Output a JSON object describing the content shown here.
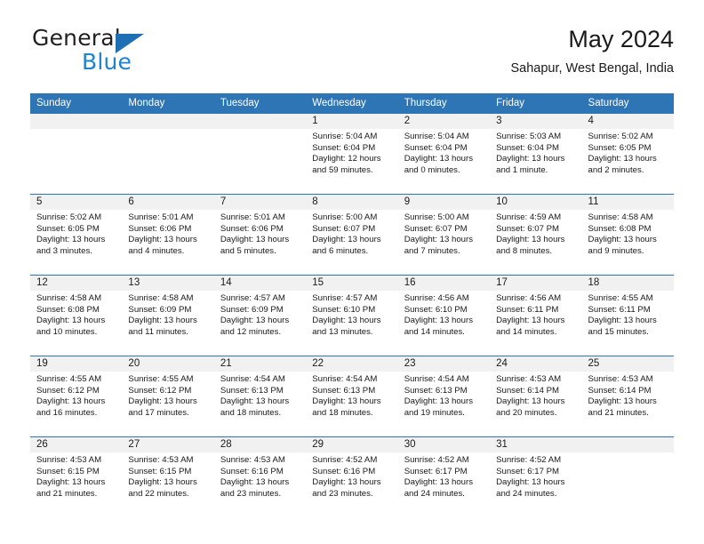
{
  "brand": {
    "name_part1": "General",
    "name_part2": "Blue",
    "triangle_color": "#1f6fb4",
    "blue_color": "#1f83d0"
  },
  "header": {
    "title": "May 2024",
    "subtitle": "Sahapur, West Bengal, India",
    "header_bg": "#2e75b6",
    "header_text_color": "#ffffff"
  },
  "calendar": {
    "weekday_headers": [
      "Sunday",
      "Monday",
      "Tuesday",
      "Wednesday",
      "Thursday",
      "Friday",
      "Saturday"
    ],
    "weeks": [
      [
        {
          "day": "",
          "lines": [
            "",
            "",
            "",
            ""
          ],
          "empty": true
        },
        {
          "day": "",
          "lines": [
            "",
            "",
            "",
            ""
          ],
          "empty": true
        },
        {
          "day": "",
          "lines": [
            "",
            "",
            "",
            ""
          ],
          "empty": true
        },
        {
          "day": "1",
          "lines": [
            "Sunrise: 5:04 AM",
            "Sunset: 6:04 PM",
            "Daylight: 12 hours",
            "and 59 minutes."
          ]
        },
        {
          "day": "2",
          "lines": [
            "Sunrise: 5:04 AM",
            "Sunset: 6:04 PM",
            "Daylight: 13 hours",
            "and 0 minutes."
          ]
        },
        {
          "day": "3",
          "lines": [
            "Sunrise: 5:03 AM",
            "Sunset: 6:04 PM",
            "Daylight: 13 hours",
            "and 1 minute."
          ]
        },
        {
          "day": "4",
          "lines": [
            "Sunrise: 5:02 AM",
            "Sunset: 6:05 PM",
            "Daylight: 13 hours",
            "and 2 minutes."
          ]
        }
      ],
      [
        {
          "day": "5",
          "lines": [
            "Sunrise: 5:02 AM",
            "Sunset: 6:05 PM",
            "Daylight: 13 hours",
            "and 3 minutes."
          ]
        },
        {
          "day": "6",
          "lines": [
            "Sunrise: 5:01 AM",
            "Sunset: 6:06 PM",
            "Daylight: 13 hours",
            "and 4 minutes."
          ]
        },
        {
          "day": "7",
          "lines": [
            "Sunrise: 5:01 AM",
            "Sunset: 6:06 PM",
            "Daylight: 13 hours",
            "and 5 minutes."
          ]
        },
        {
          "day": "8",
          "lines": [
            "Sunrise: 5:00 AM",
            "Sunset: 6:07 PM",
            "Daylight: 13 hours",
            "and 6 minutes."
          ]
        },
        {
          "day": "9",
          "lines": [
            "Sunrise: 5:00 AM",
            "Sunset: 6:07 PM",
            "Daylight: 13 hours",
            "and 7 minutes."
          ]
        },
        {
          "day": "10",
          "lines": [
            "Sunrise: 4:59 AM",
            "Sunset: 6:07 PM",
            "Daylight: 13 hours",
            "and 8 minutes."
          ]
        },
        {
          "day": "11",
          "lines": [
            "Sunrise: 4:58 AM",
            "Sunset: 6:08 PM",
            "Daylight: 13 hours",
            "and 9 minutes."
          ]
        }
      ],
      [
        {
          "day": "12",
          "lines": [
            "Sunrise: 4:58 AM",
            "Sunset: 6:08 PM",
            "Daylight: 13 hours",
            "and 10 minutes."
          ]
        },
        {
          "day": "13",
          "lines": [
            "Sunrise: 4:58 AM",
            "Sunset: 6:09 PM",
            "Daylight: 13 hours",
            "and 11 minutes."
          ]
        },
        {
          "day": "14",
          "lines": [
            "Sunrise: 4:57 AM",
            "Sunset: 6:09 PM",
            "Daylight: 13 hours",
            "and 12 minutes."
          ]
        },
        {
          "day": "15",
          "lines": [
            "Sunrise: 4:57 AM",
            "Sunset: 6:10 PM",
            "Daylight: 13 hours",
            "and 13 minutes."
          ]
        },
        {
          "day": "16",
          "lines": [
            "Sunrise: 4:56 AM",
            "Sunset: 6:10 PM",
            "Daylight: 13 hours",
            "and 14 minutes."
          ]
        },
        {
          "day": "17",
          "lines": [
            "Sunrise: 4:56 AM",
            "Sunset: 6:11 PM",
            "Daylight: 13 hours",
            "and 14 minutes."
          ]
        },
        {
          "day": "18",
          "lines": [
            "Sunrise: 4:55 AM",
            "Sunset: 6:11 PM",
            "Daylight: 13 hours",
            "and 15 minutes."
          ]
        }
      ],
      [
        {
          "day": "19",
          "lines": [
            "Sunrise: 4:55 AM",
            "Sunset: 6:12 PM",
            "Daylight: 13 hours",
            "and 16 minutes."
          ]
        },
        {
          "day": "20",
          "lines": [
            "Sunrise: 4:55 AM",
            "Sunset: 6:12 PM",
            "Daylight: 13 hours",
            "and 17 minutes."
          ]
        },
        {
          "day": "21",
          "lines": [
            "Sunrise: 4:54 AM",
            "Sunset: 6:13 PM",
            "Daylight: 13 hours",
            "and 18 minutes."
          ]
        },
        {
          "day": "22",
          "lines": [
            "Sunrise: 4:54 AM",
            "Sunset: 6:13 PM",
            "Daylight: 13 hours",
            "and 18 minutes."
          ]
        },
        {
          "day": "23",
          "lines": [
            "Sunrise: 4:54 AM",
            "Sunset: 6:13 PM",
            "Daylight: 13 hours",
            "and 19 minutes."
          ]
        },
        {
          "day": "24",
          "lines": [
            "Sunrise: 4:53 AM",
            "Sunset: 6:14 PM",
            "Daylight: 13 hours",
            "and 20 minutes."
          ]
        },
        {
          "day": "25",
          "lines": [
            "Sunrise: 4:53 AM",
            "Sunset: 6:14 PM",
            "Daylight: 13 hours",
            "and 21 minutes."
          ]
        }
      ],
      [
        {
          "day": "26",
          "lines": [
            "Sunrise: 4:53 AM",
            "Sunset: 6:15 PM",
            "Daylight: 13 hours",
            "and 21 minutes."
          ]
        },
        {
          "day": "27",
          "lines": [
            "Sunrise: 4:53 AM",
            "Sunset: 6:15 PM",
            "Daylight: 13 hours",
            "and 22 minutes."
          ]
        },
        {
          "day": "28",
          "lines": [
            "Sunrise: 4:53 AM",
            "Sunset: 6:16 PM",
            "Daylight: 13 hours",
            "and 23 minutes."
          ]
        },
        {
          "day": "29",
          "lines": [
            "Sunrise: 4:52 AM",
            "Sunset: 6:16 PM",
            "Daylight: 13 hours",
            "and 23 minutes."
          ]
        },
        {
          "day": "30",
          "lines": [
            "Sunrise: 4:52 AM",
            "Sunset: 6:17 PM",
            "Daylight: 13 hours",
            "and 24 minutes."
          ]
        },
        {
          "day": "31",
          "lines": [
            "Sunrise: 4:52 AM",
            "Sunset: 6:17 PM",
            "Daylight: 13 hours",
            "and 24 minutes."
          ]
        },
        {
          "day": "",
          "lines": [
            "",
            "",
            "",
            ""
          ],
          "empty": true
        }
      ]
    ]
  }
}
